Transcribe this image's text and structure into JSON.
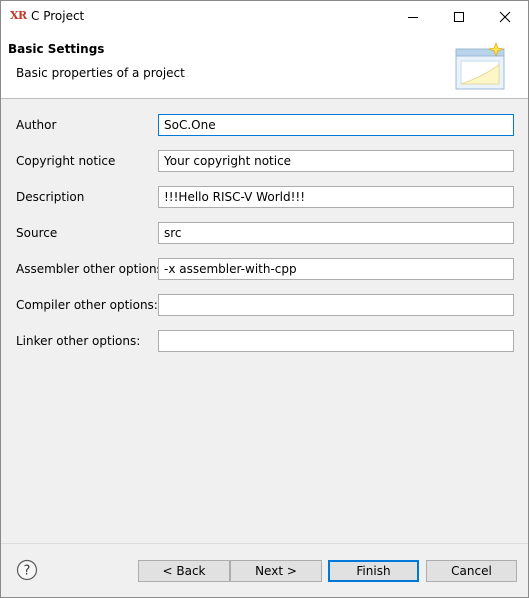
{
  "window": {
    "icon_text": "XR",
    "title": "C Project"
  },
  "banner": {
    "title": "Basic Settings",
    "subtitle": "Basic properties of a project"
  },
  "fields": [
    {
      "label": "Author",
      "value": "SoC.One"
    },
    {
      "label": "Copyright notice",
      "value": "Your copyright notice"
    },
    {
      "label": "Description",
      "value": "!!!Hello RISC-V World!!!"
    },
    {
      "label": "Source",
      "value": "src"
    },
    {
      "label": "Assembler other options:",
      "value": "-x assembler-with-cpp"
    },
    {
      "label": "Compiler other options:",
      "value": ""
    },
    {
      "label": "Linker other options:",
      "value": ""
    }
  ],
  "buttons": {
    "back": "< Back",
    "next": "Next >",
    "finish": "Finish",
    "cancel": "Cancel"
  },
  "colors": {
    "focus_border": "#0078d7",
    "app_icon": "#c0392b"
  }
}
